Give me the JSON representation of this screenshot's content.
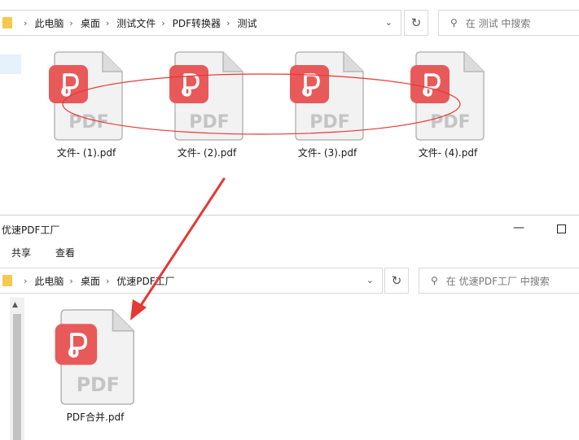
{
  "top_window": {
    "breadcrumbs": [
      "此电脑",
      "桌面",
      "测试文件",
      "PDF转换器",
      "测试"
    ],
    "search_placeholder": "在 测试 中搜索",
    "files": [
      {
        "name": "文件- (1).pdf"
      },
      {
        "name": "文件- (2).pdf"
      },
      {
        "name": "文件- (3).pdf"
      },
      {
        "name": "文件- (4).pdf"
      }
    ]
  },
  "bottom_window": {
    "title": "优速PDF工厂",
    "ribbon_tabs": [
      "共享",
      "查看"
    ],
    "breadcrumbs": [
      "此电脑",
      "桌面",
      "优速PDF工厂"
    ],
    "search_placeholder": "在 优速PDF工厂 中搜索",
    "files": [
      {
        "name": "PDF合并.pdf"
      }
    ]
  },
  "pdf_icon_text": "PDF",
  "icons": {
    "folder": "folder-icon",
    "breadcrumb_separator": "chevron-right-icon",
    "dropdown": "chevron-down-icon",
    "refresh": "refresh-icon",
    "search": "search-icon",
    "pdf_file": "pdf-file-icon",
    "minimize": "minimize-icon",
    "maximize": "maximize-icon",
    "scroll_up": "scroll-up-arrow-icon"
  },
  "colors": {
    "pdf_badge": "#e85a5a",
    "annotation": "#e53935",
    "folder": "#f5c94c",
    "selection": "#e5f1fb"
  }
}
